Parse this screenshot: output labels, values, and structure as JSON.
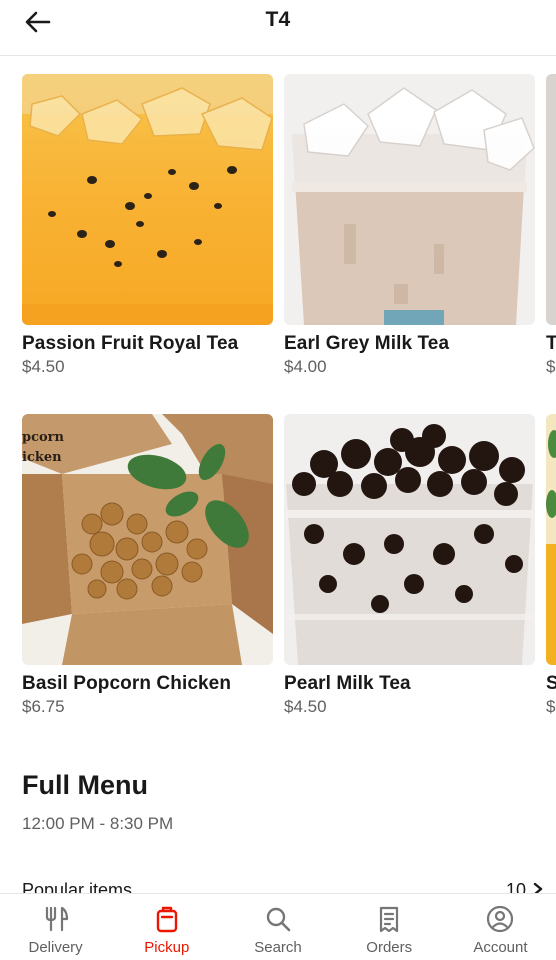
{
  "header": {
    "title": "T4",
    "back_icon": "arrow-left-icon"
  },
  "accent_color": "#eb1700",
  "items": [
    {
      "name": "Passion Fruit Royal Tea",
      "price": "$4.50"
    },
    {
      "name": "Earl Grey Milk Tea",
      "price": "$4.00"
    },
    {
      "name": "T",
      "price": "$"
    },
    {
      "name": "Basil Popcorn Chicken",
      "price": "$6.75",
      "box_text": "pcorn\nicken"
    },
    {
      "name": "Pearl Milk Tea",
      "price": "$4.50"
    },
    {
      "name": "S",
      "price": "$"
    }
  ],
  "full_menu": {
    "title": "Full Menu",
    "hours": "12:00 PM - 8:30 PM"
  },
  "popular": {
    "label": "Popular items",
    "count": "10"
  },
  "nav": [
    {
      "label": "Delivery",
      "icon": "fork-knife-icon",
      "active": false
    },
    {
      "label": "Pickup",
      "icon": "bag-icon",
      "active": true
    },
    {
      "label": "Search",
      "icon": "search-icon",
      "active": false
    },
    {
      "label": "Orders",
      "icon": "receipt-icon",
      "active": false
    },
    {
      "label": "Account",
      "icon": "account-icon",
      "active": false
    }
  ]
}
